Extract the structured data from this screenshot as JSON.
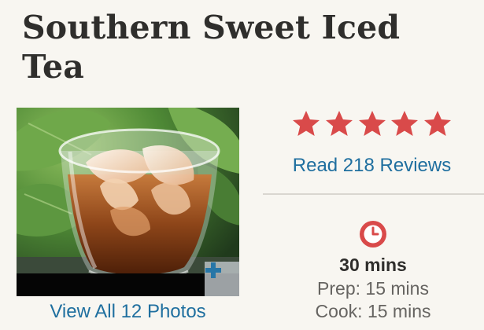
{
  "recipe": {
    "title": "Southern Sweet Iced Tea"
  },
  "photo": {
    "view_all_label": "View All 12 Photos",
    "enlarge_icon": "plus-icon"
  },
  "rating": {
    "stars": 5,
    "max_stars": 5,
    "star_color": "#d94a4a",
    "reviews_label": "Read 218 Reviews"
  },
  "times": {
    "icon": "clock-icon",
    "icon_color": "#d94a4a",
    "total": "30 mins",
    "prep": "Prep: 15 mins",
    "cook": "Cook: 15 mins"
  },
  "colors": {
    "link": "#1f6f9f",
    "background": "#f8f6f1"
  }
}
